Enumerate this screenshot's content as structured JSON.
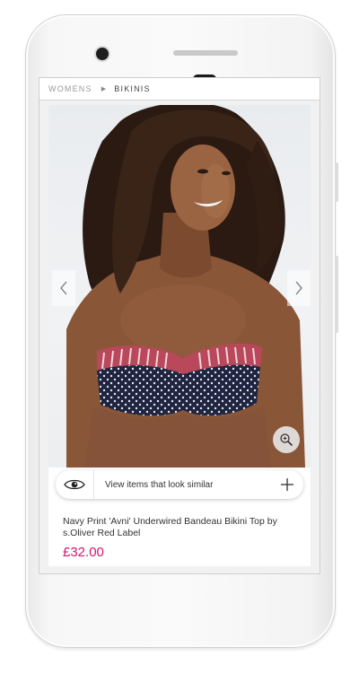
{
  "breadcrumb": {
    "parent": "WOMENS",
    "current": "BIKINIS"
  },
  "similar": {
    "label": "View items that look similar"
  },
  "product": {
    "title": "Navy Print 'Avni' Underwired Bandeau Bikini Top by s.Oliver Red Label",
    "price": "£32.00"
  },
  "icons": {
    "breadcrumb_separator": "triangle-right-icon",
    "prev": "chevron-left-icon",
    "next": "chevron-right-icon",
    "zoom": "zoom-in-icon",
    "similar": "eye-icon",
    "add": "plus-icon"
  },
  "colors": {
    "price": "#d6146f",
    "breadcrumb_inactive": "#9a9a9a",
    "breadcrumb_active": "#444444"
  }
}
